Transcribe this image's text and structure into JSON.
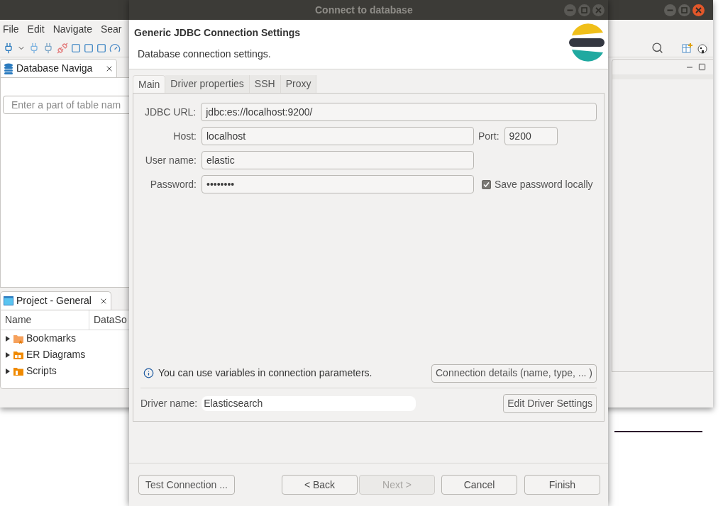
{
  "main_window": {
    "menu": [
      {
        "label": "File"
      },
      {
        "label": "Edit"
      },
      {
        "label": "Navigate"
      },
      {
        "label": "Sear"
      }
    ],
    "navigator": {
      "tab": "Database Naviga",
      "filter_placeholder": "Enter a part of table nam"
    },
    "project": {
      "tab": "Project - General",
      "columns": [
        "Name",
        "DataSo"
      ],
      "items": [
        {
          "label": "Bookmarks",
          "kind": "bookmarks",
          "expanded": false
        },
        {
          "label": "ER Diagrams",
          "kind": "diagrams",
          "expanded": false
        },
        {
          "label": "Scripts",
          "kind": "scripts",
          "expanded": false
        }
      ]
    }
  },
  "dialog": {
    "title": "Connect to database",
    "heading": "Generic JDBC Connection Settings",
    "subheading": "Database connection settings.",
    "tabs": [
      {
        "label": "Main",
        "selected": true
      },
      {
        "label": "Driver properties",
        "selected": false
      },
      {
        "label": "SSH",
        "selected": false
      },
      {
        "label": "Proxy",
        "selected": false
      }
    ],
    "jdbc_url": {
      "label": "JDBC URL:",
      "value": "jdbc:es://localhost:9200/"
    },
    "host": {
      "label": "Host:",
      "value": "localhost"
    },
    "port": {
      "label": "Port:",
      "value": "9200"
    },
    "user_name": {
      "label": "User name:",
      "value": "elastic"
    },
    "password": {
      "label": "Password:",
      "value": "••••••••"
    },
    "save_password": {
      "label": "Save password locally",
      "checked": true
    },
    "info": "You can use variables in connection parameters.",
    "connection_details_button": "Connection details (name, type, ... )",
    "driver": {
      "label": "Driver name:",
      "value": "Elasticsearch"
    },
    "edit_driver_button": "Edit Driver Settings",
    "test_button": "Test Connection ...",
    "buttons": [
      {
        "label": "< Back",
        "disabled": false
      },
      {
        "label": "Next >",
        "disabled": true
      },
      {
        "label": "Cancel",
        "disabled": false
      },
      {
        "label": "Finish",
        "disabled": false
      }
    ]
  }
}
